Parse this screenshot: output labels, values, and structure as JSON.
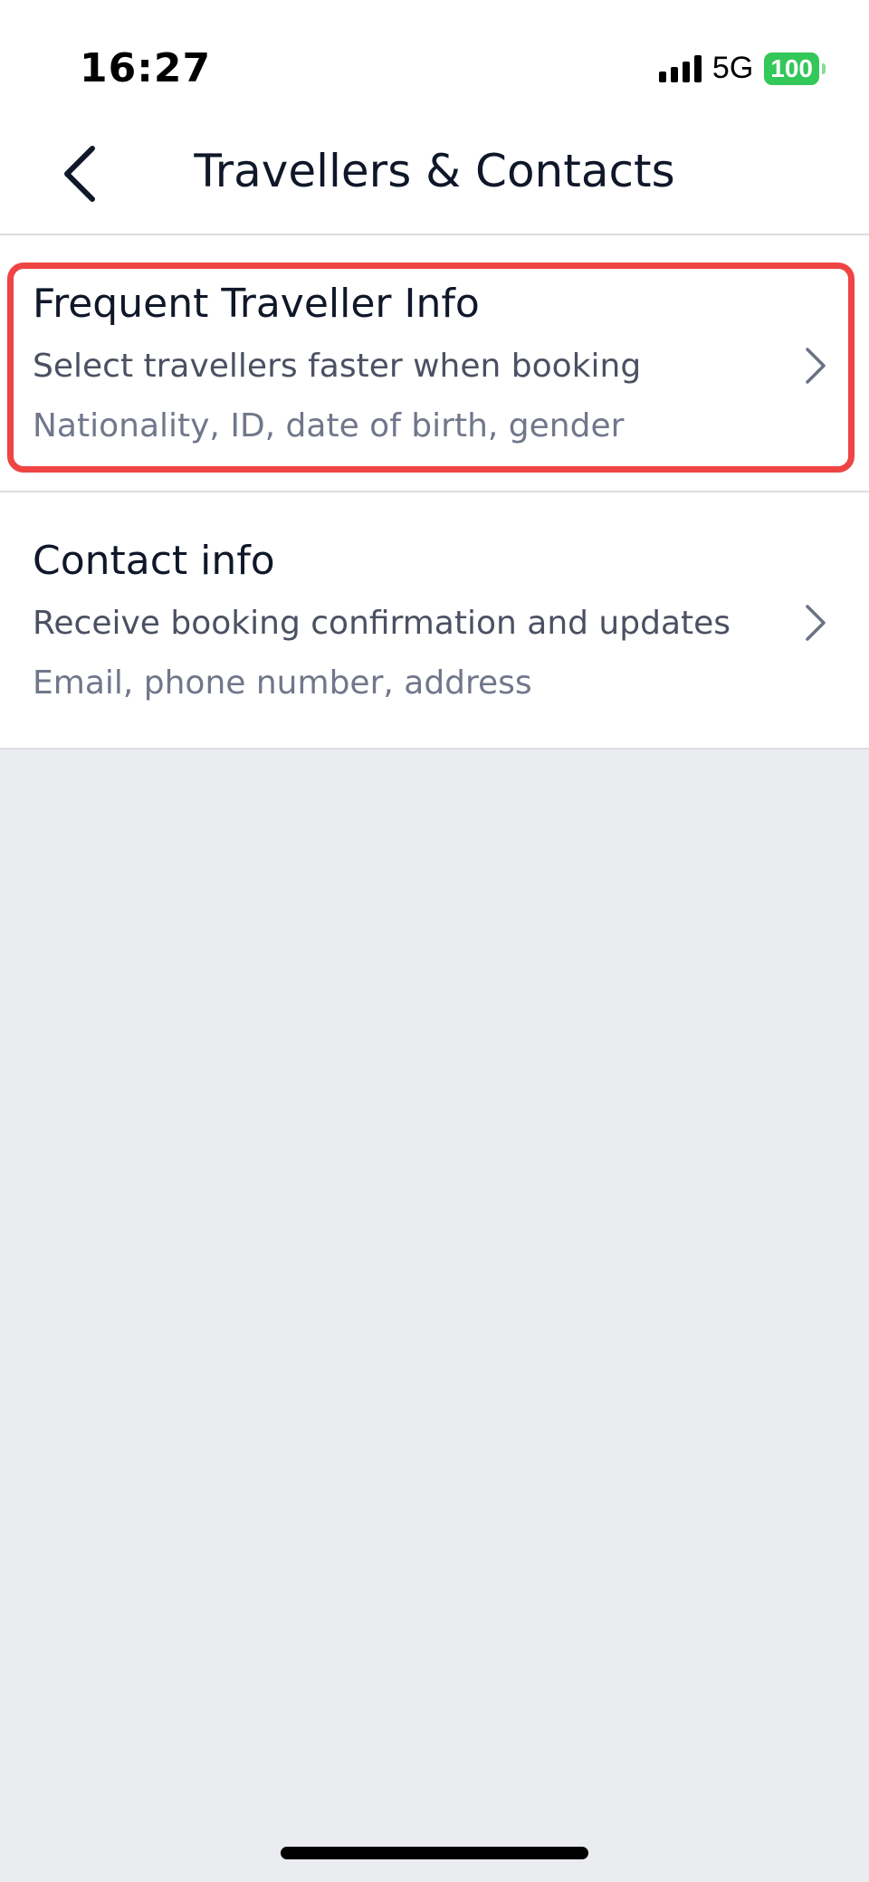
{
  "status_bar": {
    "time": "16:27",
    "network": "5G",
    "battery": "100"
  },
  "header": {
    "title": "Travellers & Contacts",
    "back_icon": "chevron-left-icon"
  },
  "items": [
    {
      "title": "Frequent Traveller Info",
      "subtitle": "Select travellers faster when booking",
      "detail": "Nationality, ID, date of birth, gender",
      "icon": "chevron-right-icon"
    },
    {
      "title": "Contact info",
      "subtitle": "Receive booking confirmation and updates",
      "detail": "Email, phone number, address",
      "icon": "chevron-right-icon"
    }
  ],
  "colors": {
    "highlight": "#ef4444",
    "background": "#ebecf0",
    "battery": "#34c759"
  }
}
